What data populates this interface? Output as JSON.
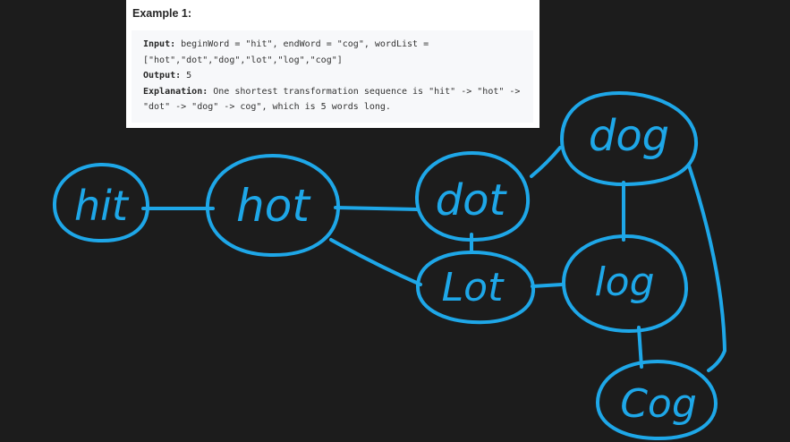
{
  "example": {
    "title": "Example 1:",
    "input_label": "Input:",
    "input_line1": " beginWord = \"hit\", endWord = \"cog\", wordList =",
    "input_line2": "[\"hot\",\"dot\",\"dog\",\"lot\",\"log\",\"cog\"]",
    "output_label": "Output:",
    "output_value": " 5",
    "explanation_label": "Explanation:",
    "explanation_line1": " One shortest transformation sequence is \"hit\" -> \"hot\" ->",
    "explanation_line2": "\"dot\" -> \"dog\" -> cog\", which is 5 words long."
  },
  "diagram": {
    "stroke_color": "#1ea7e8",
    "background": "#1c1c1c",
    "nodes": {
      "hit": "hit",
      "hot": "hot",
      "dot": "dot",
      "lot": "Lot",
      "dog": "dog",
      "log": "log",
      "cog": "Cog"
    }
  }
}
